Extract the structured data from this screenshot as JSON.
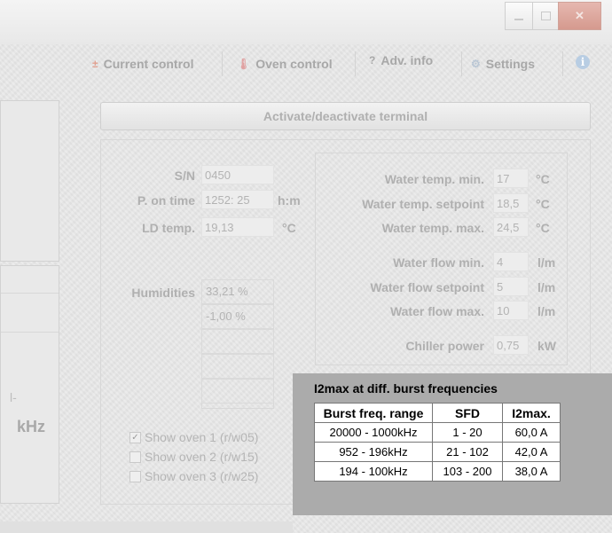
{
  "tabs": [
    {
      "label": "Current control",
      "icon": "current-control-icon"
    },
    {
      "label": "Oven control",
      "icon": "thermometer-icon"
    },
    {
      "label": "Adv. info",
      "icon": "question-icon"
    },
    {
      "label": "Settings",
      "icon": "settings-icon"
    }
  ],
  "activate_button": "Activate/deactivate terminal",
  "left_unit": "kHz",
  "device": {
    "sn_label": "S/N",
    "sn_value": "0450",
    "pon_label": "P. on time",
    "pon_value": "1252: 25",
    "pon_unit": "h:m",
    "ld_label": "LD temp.",
    "ld_value": "19,13",
    "ld_unit": "°C"
  },
  "humidities": {
    "label": "Humidities",
    "values": [
      "33,21 %",
      "-1,00 %"
    ]
  },
  "checkboxes": [
    {
      "label": "Show oven 1 (r/w05)",
      "checked": true
    },
    {
      "label": "Show oven 2 (r/w15)",
      "checked": false
    },
    {
      "label": "Show oven 3 (r/w25)",
      "checked": false
    }
  ],
  "water": {
    "temp_min_label": "Water temp. min.",
    "temp_min_value": "17",
    "temp_min_unit": "°C",
    "temp_set_label": "Water temp. setpoint",
    "temp_set_value": "18,5",
    "temp_set_unit": "°C",
    "temp_max_label": "Water temp. max.",
    "temp_max_value": "24,5",
    "temp_max_unit": "°C",
    "flow_min_label": "Water flow min.",
    "flow_min_value": "4",
    "flow_min_unit": "l/m",
    "flow_set_label": "Water flow setpoint",
    "flow_set_value": "5",
    "flow_set_unit": "l/m",
    "flow_max_label": "Water flow max.",
    "flow_max_value": "10",
    "flow_max_unit": "l/m",
    "chiller_label": "Chiller power",
    "chiller_value": "0,75",
    "chiller_unit": "kW"
  },
  "popup": {
    "title": "I2max at diff. burst frequencies",
    "headers": [
      "Burst freq. range",
      "SFD",
      "I2max."
    ],
    "rows": [
      [
        "20000 - 1000kHz",
        "1 - 20",
        "60,0 A"
      ],
      [
        "952 - 196kHz",
        "21 - 102",
        "42,0 A"
      ],
      [
        "194 - 100kHz",
        "103 - 200",
        "38,0 A"
      ]
    ]
  }
}
